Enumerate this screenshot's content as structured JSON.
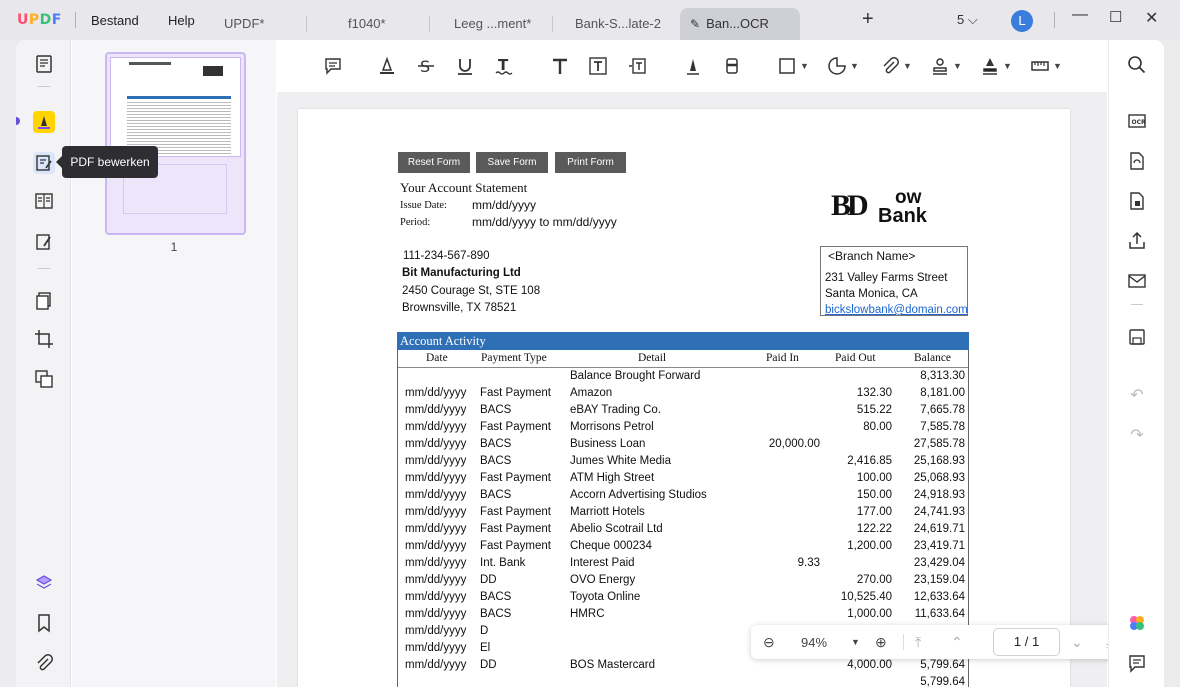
{
  "app": {
    "logo": "UPDF",
    "menu": [
      "Bestand",
      "Help"
    ]
  },
  "tabs": [
    {
      "label": "UPDF*"
    },
    {
      "label": "f1040*"
    },
    {
      "label": "Leeg ...ment*"
    },
    {
      "label": "Bank-S...late-2"
    },
    {
      "label": "Ban...OCR"
    }
  ],
  "window": {
    "tab_count": "5",
    "user_initial": "L"
  },
  "sidebar": {
    "tooltip": "PDF bewerken"
  },
  "thumbnails": {
    "page_label": "1"
  },
  "document": {
    "form_buttons": [
      "Reset Form",
      "Save Form",
      "Print Form",
      ""
    ],
    "statement_title": "Your Account Statement",
    "issue_label": "Issue Date:",
    "issue_value": "mm/dd/yyyy",
    "period_label": "Period:",
    "period_value": "mm/dd/yyyy to mm/dd/yyyy",
    "logo_text": "ow",
    "logo_bank": "Bank",
    "phone": "111-234-567-890",
    "company": "Bit Manufacturing Ltd",
    "address1": "2450 Courage St, STE 108",
    "address2": "Brownsville, TX 78521",
    "branch": {
      "name": "<Branch Name>",
      "street": "231 Valley Farms Street",
      "city": "Santa Monica, CA",
      "email": "bickslowbank@domain.com"
    },
    "activity_title": "Account Activity",
    "columns": [
      "Date",
      "Payment Type",
      "Detail",
      "Paid In",
      "Paid Out",
      "Balance"
    ],
    "rows": [
      [
        "",
        "",
        "Balance Brought Forward",
        "",
        "",
        "8,313.30"
      ],
      [
        "mm/dd/yyyy",
        "Fast Payment",
        "Amazon",
        "",
        "132.30",
        "8,181.00"
      ],
      [
        "mm/dd/yyyy",
        "BACS",
        "eBAY Trading Co.",
        "",
        "515.22",
        "7,665.78"
      ],
      [
        "mm/dd/yyyy",
        "Fast Payment",
        "Morrisons Petrol",
        "",
        "80.00",
        "7,585.78"
      ],
      [
        "mm/dd/yyyy",
        "BACS",
        "Business Loan",
        "20,000.00",
        "",
        "27,585.78"
      ],
      [
        "mm/dd/yyyy",
        "BACS",
        "Jumes White Media",
        "",
        "2,416.85",
        "25,168.93"
      ],
      [
        "mm/dd/yyyy",
        "Fast Payment",
        "ATM High Street",
        "",
        "100.00",
        "25,068.93"
      ],
      [
        "mm/dd/yyyy",
        "BACS",
        "Accorn Advertising Studios",
        "",
        "150.00",
        "24,918.93"
      ],
      [
        "mm/dd/yyyy",
        "Fast Payment",
        "Marriott Hotels",
        "",
        "177.00",
        "24,741.93"
      ],
      [
        "mm/dd/yyyy",
        "Fast Payment",
        "Abelio Scotrail Ltd",
        "",
        "122.22",
        "24,619.71"
      ],
      [
        "mm/dd/yyyy",
        "Fast Payment",
        "Cheque 000234",
        "",
        "1,200.00",
        "23,419.71"
      ],
      [
        "mm/dd/yyyy",
        "Int. Bank",
        "Interest Paid",
        "9.33",
        "",
        "23,429.04"
      ],
      [
        "mm/dd/yyyy",
        "DD",
        "OVO Energy",
        "",
        "270.00",
        "23,159.04"
      ],
      [
        "mm/dd/yyyy",
        "BACS",
        "Toyota Online",
        "",
        "10,525.40",
        "12,633.64"
      ],
      [
        "mm/dd/yyyy",
        "BACS",
        "HMRC",
        "",
        "1,000.00",
        "11,633.64"
      ],
      [
        "mm/dd/yyyy",
        "D",
        "",
        "",
        "",
        "11,353.64"
      ],
      [
        "mm/dd/yyyy",
        "El",
        "",
        "",
        "",
        "9,799.64"
      ],
      [
        "mm/dd/yyyy",
        "DD",
        "BOS Mastercard",
        "",
        "4,000.00",
        "5,799.64"
      ],
      [
        "",
        "",
        "",
        "",
        "",
        "5,799.64"
      ]
    ]
  },
  "zoombar": {
    "zoom": "94%",
    "page_current": "1",
    "page_sep": "/",
    "page_total": "1"
  }
}
